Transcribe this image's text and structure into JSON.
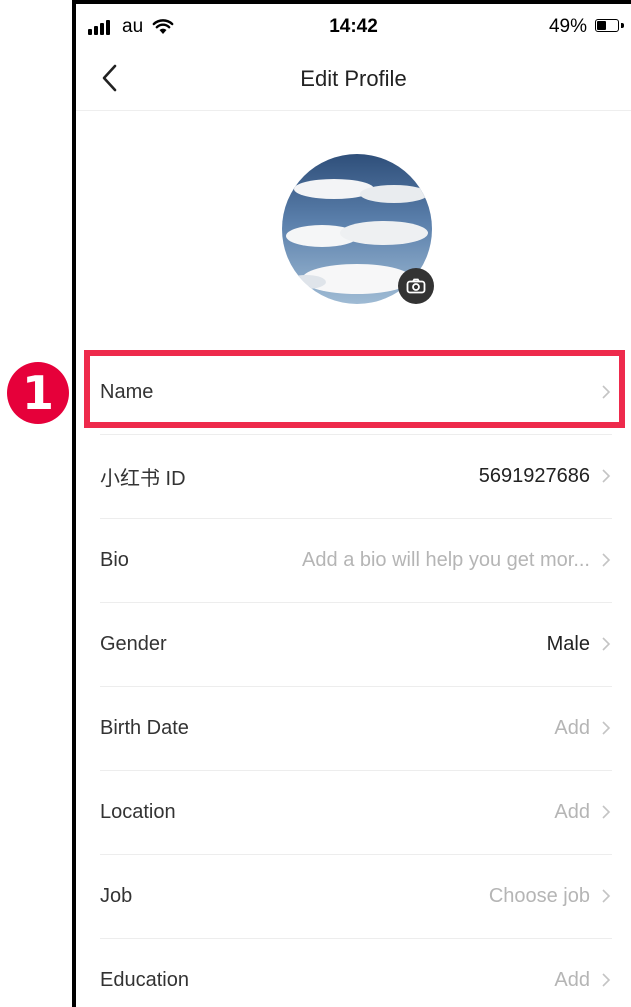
{
  "status_bar": {
    "carrier": "au",
    "time": "14:42",
    "battery": "49%",
    "battery_level": 0.49
  },
  "header": {
    "title": "Edit Profile"
  },
  "avatar": {
    "image": "sky-with-clouds",
    "camera_icon": "camera-icon"
  },
  "fields": [
    {
      "label": "Name",
      "value": ""
    },
    {
      "label": "小红书 ID",
      "value": "5691927686"
    },
    {
      "label": "Bio",
      "value": "Add a bio will help you get mor..."
    },
    {
      "label": "Gender",
      "value": "Male"
    },
    {
      "label": "Birth Date",
      "value": "Add"
    },
    {
      "label": "Location",
      "value": "Add"
    },
    {
      "label": "Job",
      "value": "Choose job"
    },
    {
      "label": "Education",
      "value": "Add"
    }
  ],
  "annotation": {
    "step": "1",
    "color": "#ee2a4c"
  },
  "colors": {
    "label": "#333333",
    "placeholder": "#b5b5b5",
    "value": "#222222"
  }
}
